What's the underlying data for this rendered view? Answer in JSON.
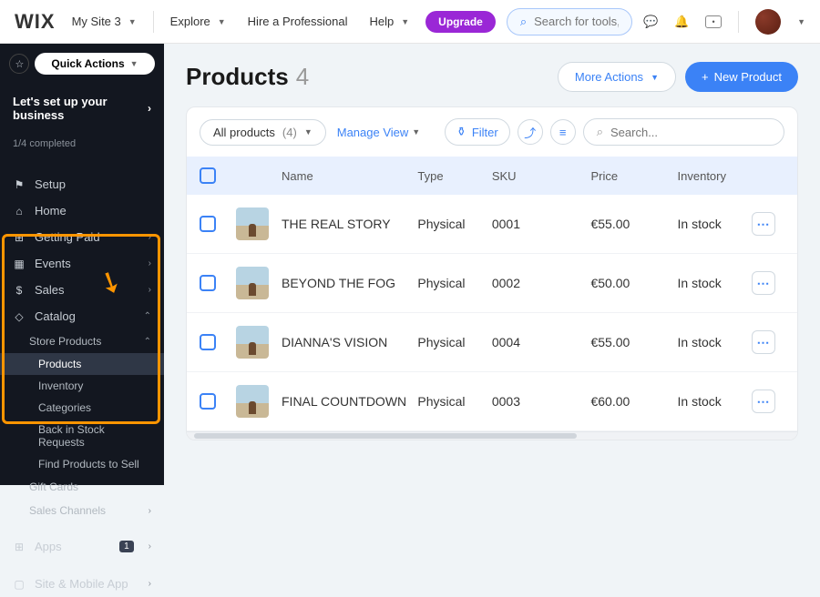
{
  "topbar": {
    "logo": "WIX",
    "siteName": "My Site 3",
    "nav": {
      "explore": "Explore",
      "hire": "Hire a Professional",
      "help": "Help"
    },
    "upgrade": "Upgrade",
    "searchPlaceholder": "Search for tools, apps, help & more..."
  },
  "sidebar": {
    "quickActions": "Quick Actions",
    "setupTitle": "Let's set up your business",
    "progress": "1/4 completed",
    "items": {
      "setup": "Setup",
      "home": "Home",
      "gettingPaid": "Getting Paid",
      "events": "Events",
      "sales": "Sales",
      "catalog": "Catalog",
      "storeProducts": "Store Products",
      "products": "Products",
      "inventory": "Inventory",
      "categories": "Categories",
      "backInStock": "Back in Stock Requests",
      "findProducts": "Find Products to Sell",
      "giftCards": "Gift Cards",
      "salesChannels": "Sales Channels",
      "apps": "Apps",
      "appsBadge": "1",
      "siteApp": "Site & Mobile App"
    }
  },
  "page": {
    "title": "Products",
    "count": "4",
    "moreActions": "More Actions",
    "newProduct": "New Product"
  },
  "toolbar": {
    "allProducts": "All products",
    "allCount": "(4)",
    "manageView": "Manage View",
    "filter": "Filter",
    "searchPlaceholder": "Search..."
  },
  "columns": {
    "name": "Name",
    "type": "Type",
    "sku": "SKU",
    "price": "Price",
    "inventory": "Inventory"
  },
  "rows": [
    {
      "name": "THE REAL STORY",
      "type": "Physical",
      "sku": "0001",
      "price": "€55.00",
      "inventory": "In stock"
    },
    {
      "name": "BEYOND THE FOG",
      "type": "Physical",
      "sku": "0002",
      "price": "€50.00",
      "inventory": "In stock"
    },
    {
      "name": "DIANNA'S VISION",
      "type": "Physical",
      "sku": "0004",
      "price": "€55.00",
      "inventory": "In stock"
    },
    {
      "name": "FINAL COUNTDOWN",
      "type": "Physical",
      "sku": "0003",
      "price": "€60.00",
      "inventory": "In stock"
    }
  ]
}
